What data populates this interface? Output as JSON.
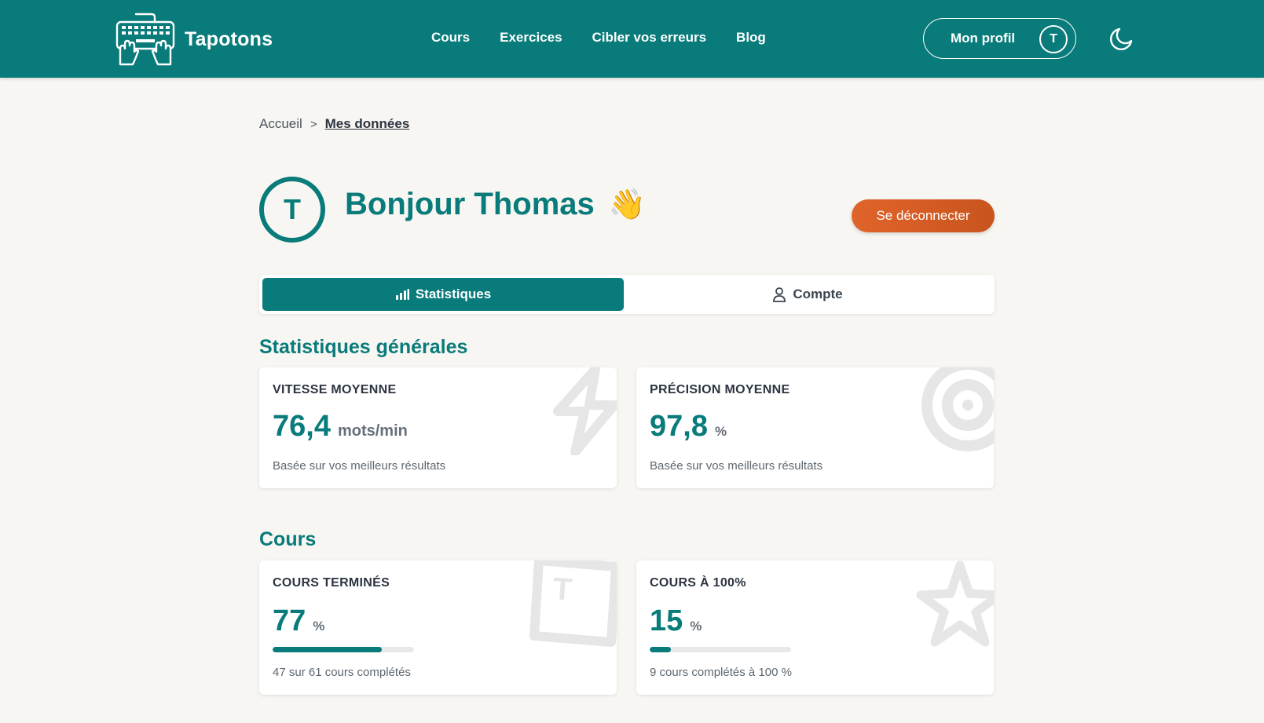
{
  "header": {
    "brand": "Tapotons",
    "nav": [
      "Cours",
      "Exercices",
      "Cibler vos erreurs",
      "Blog"
    ],
    "profile_label": "Mon profil",
    "profile_initial": "T",
    "theme_icon": "moon-icon"
  },
  "breadcrumb": {
    "home": "Accueil",
    "separator": ">",
    "current": "Mes données"
  },
  "user": {
    "initial": "T",
    "greeting": "Bonjour Thomas",
    "wave": "👋"
  },
  "logout_label": "Se déconnecter",
  "tabs": {
    "stats": "Statistiques",
    "account": "Compte"
  },
  "sections": {
    "general": {
      "title": "Statistiques générales",
      "speed": {
        "label": "VITESSE MOYENNE",
        "value": "76,4",
        "unit": "mots/min",
        "note": "Basée sur vos meilleurs résultats",
        "icon": "lightning-icon"
      },
      "accuracy": {
        "label": "PRÉCISION MOYENNE",
        "value": "97,8",
        "unit": "%",
        "note": "Basée sur vos meilleurs résultats",
        "icon": "target-icon"
      }
    },
    "courses": {
      "title": "Cours",
      "completed": {
        "label": "COURS TERMINÉS",
        "value": "77",
        "unit": "%",
        "progress": 0.77,
        "note": "47 sur 61 cours complétés",
        "icon": "key-icon"
      },
      "perfect": {
        "label": "COURS À 100%",
        "value": "15",
        "unit": "%",
        "progress": 0.15,
        "note": "9 cours complétés à 100 %",
        "icon": "star-icon"
      }
    }
  },
  "colors": {
    "primary": "#087b7a",
    "accent": "#e0642a",
    "background": "#f8f6f2"
  }
}
